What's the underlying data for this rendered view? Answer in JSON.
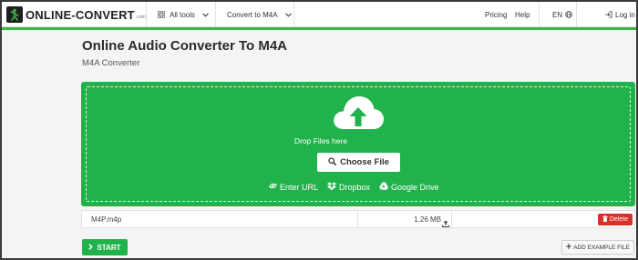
{
  "header": {
    "logo_text": "ONLINE-CONVERT",
    "logo_sub": ".com",
    "all_tools_label": "All tools",
    "convert_menu_label": "Convert to M4A",
    "pricing_label": "Pricing",
    "help_label": "Help",
    "language_label": "EN",
    "login_label": "Log in"
  },
  "main": {
    "title": "Online Audio Converter To M4A",
    "subtitle": "M4A Converter"
  },
  "dropzone": {
    "drop_text": "Drop Files here",
    "choose_file_label": "Choose File",
    "sources": {
      "enter_url": "Enter URL",
      "dropbox": "Dropbox",
      "google_drive": "Google Drive"
    }
  },
  "file": {
    "name": "M4P.m4p",
    "size": "1.26 MB",
    "delete_label": "Delete"
  },
  "actions": {
    "start_label": "START",
    "add_example_label": "ADD EXAMPLE FILE"
  },
  "colors": {
    "brand_green": "#21b24c",
    "accent_line": "#3db54a",
    "delete_red": "#d9302a"
  },
  "icons": [
    "grid-icon",
    "chevron-down-icon",
    "globe-icon",
    "login-icon",
    "cloud-upload-icon",
    "search-icon",
    "link-icon",
    "dropbox-icon",
    "google-drive-icon",
    "upload-arrow-icon",
    "trash-icon",
    "chevron-right-icon",
    "plus-icon"
  ]
}
